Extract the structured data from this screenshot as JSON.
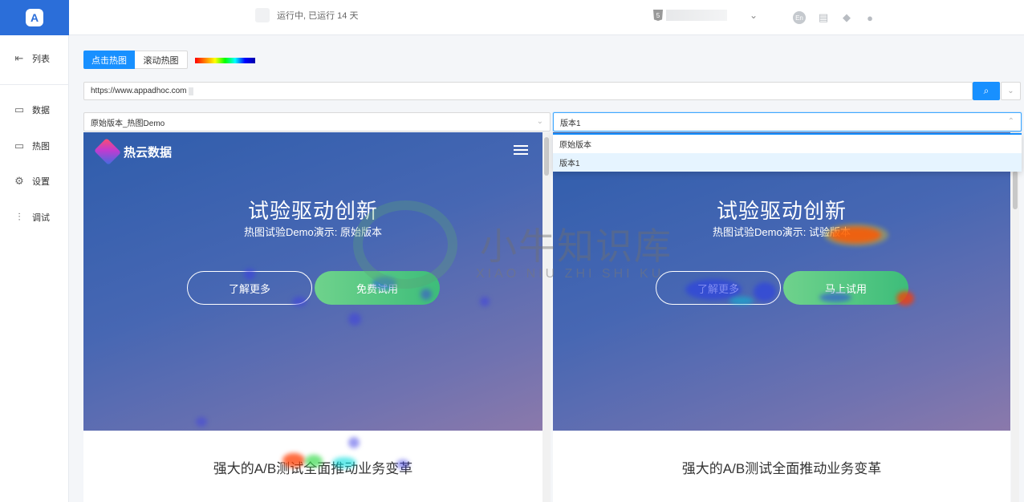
{
  "app": {
    "logo_letter": "A",
    "brand_color": "#2b6ed9",
    "accent_color": "#1890ff"
  },
  "sidebar": {
    "items": [
      {
        "label": "列表",
        "icon": "list-icon"
      },
      {
        "label": "数据",
        "icon": "monitor-chart-icon"
      },
      {
        "label": "热图",
        "icon": "monitor-heat-icon"
      },
      {
        "label": "设置",
        "icon": "gear-icon"
      },
      {
        "label": "调试",
        "icon": "sliders-icon"
      }
    ]
  },
  "topbar": {
    "status": "运行中, 已运行 14 天",
    "icons": [
      "language-en-icon",
      "book-icon",
      "bell-icon",
      "user-icon"
    ],
    "en_label": "En"
  },
  "toolbar": {
    "tabs": [
      {
        "label": "点击热图",
        "active": true
      },
      {
        "label": "滚动热图",
        "active": false
      }
    ]
  },
  "url": {
    "value": "https://www.appadhoc.com"
  },
  "compare": {
    "left_select": "原始版本_热图Demo",
    "right_select": "版本1",
    "options": [
      "原始版本",
      "版本1"
    ],
    "selected_option": "版本1"
  },
  "preview": {
    "brand": "热云数据",
    "hero_title": "试验驱动创新",
    "left_sub": "热图试验Demo演示: 原始版本",
    "right_sub": "热图试验Demo演示: 试验版本",
    "left_buttons": [
      "了解更多",
      "免费试用"
    ],
    "right_buttons": [
      "了解更多",
      "马上试用"
    ],
    "section_title": "强大的A/B测试全面推动业务变革"
  },
  "watermark": {
    "text": "小牛知识库",
    "pinyin": "XIAO NIU ZHI SHI KU"
  }
}
